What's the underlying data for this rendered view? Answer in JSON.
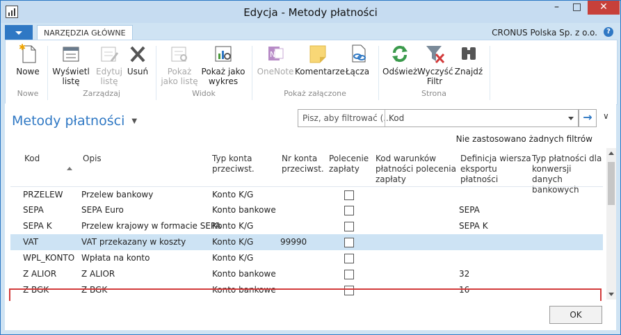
{
  "window": {
    "title": "Edycja - Metody płatności",
    "minimize": "–",
    "maximize": "□",
    "close": "✕"
  },
  "ribbon": {
    "tab": "NARZĘDZIA GŁÓWNE",
    "company": "CRONUS Polska Sp. z o.o.",
    "help": "?",
    "buttons": {
      "nowe": "Nowe",
      "wyswietl": "Wyświetl\nlistę",
      "edytuj": "Edytuj\nlistę",
      "usun": "Usuń",
      "pokaz_liste": "Pokaż\njako listę",
      "pokaz_wykres": "Pokaż jako\nwykres",
      "onenote": "OneNote",
      "komentarze": "Komentarze",
      "laczа": "Łącza",
      "odswiez": "Odśwież",
      "wyczysc": "Wyczyść\nFiltr",
      "znajdz": "Znajdź"
    },
    "groups": {
      "nowe": "Nowe",
      "zarzadzaj": "Zarządzaj",
      "widok": "Widok",
      "zalaczone": "Pokaż załączone",
      "strona": "Strona"
    }
  },
  "page": {
    "title": "Metody płatności",
    "search_placeholder": "Pisz, aby filtrować (...",
    "search_field": "Kod",
    "no_filters": "Nie zastosowano żadnych filtrów"
  },
  "columns": {
    "kod": "Kod",
    "opis": "Opis",
    "typ": "Typ konta\nprzeciwst.",
    "nr": "Nr konta\nprzeciwst.",
    "polecenie": "Polecenie\nzapłaty",
    "kod_warunkow": "Kod warunków\npłatności polecenia\nzapłaty",
    "definicja": "Definicja wiersza\neksportu\npłatności",
    "typ_platnosci": "Typ płatności dla\nkonwersji danych\nbankowych"
  },
  "rows": [
    {
      "kod": "PRZELEW",
      "opis": "Przelew bankowy",
      "typ": "Konto K/G",
      "nr": "",
      "definicja": ""
    },
    {
      "kod": "SEPA",
      "opis": "SEPA Euro",
      "typ": "Konto bankowe",
      "nr": "",
      "definicja": "SEPA"
    },
    {
      "kod": "SEPA K",
      "opis": "Przelew krajowy w formacie SEPA",
      "typ": "Konto K/G",
      "nr": "",
      "definicja": "SEPA K"
    },
    {
      "kod": "VAT",
      "opis": "VAT przekazany w koszty",
      "typ": "Konto K/G",
      "nr": "99990",
      "definicja": ""
    },
    {
      "kod": "WPL_KONTO",
      "opis": "Wpłata na konto",
      "typ": "Konto K/G",
      "nr": "",
      "definicja": ""
    },
    {
      "kod": "Z ALIOR",
      "opis": "Z ALIOR",
      "typ": "Konto bankowe",
      "nr": "",
      "definicja": "32"
    },
    {
      "kod": "Z BGK",
      "opis": "Z BGK",
      "typ": "Konto bankowe",
      "nr": "",
      "definicja": "16"
    }
  ],
  "footer": {
    "ok": "OK"
  },
  "colors": {
    "accent": "#2f78c4",
    "selected_row": "#cde3f4",
    "highlight": "#d23a3a"
  }
}
